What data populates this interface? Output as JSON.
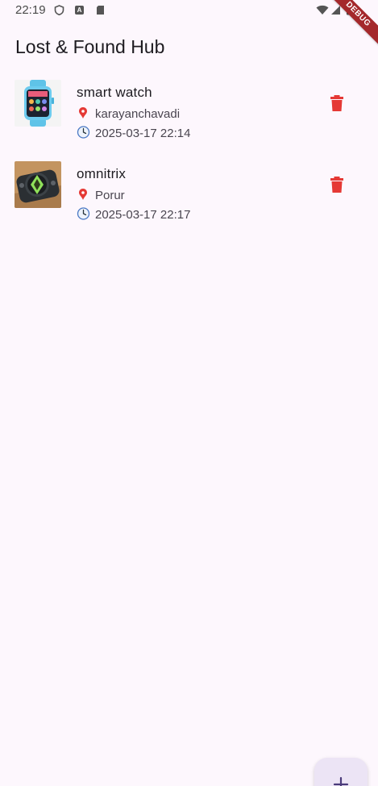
{
  "status_bar": {
    "time": "22:19",
    "icons": [
      "shield-icon",
      "a-icon",
      "sd-card-icon",
      "wifi-icon",
      "signal-icon",
      "battery-icon"
    ]
  },
  "debug_banner": "DEBUG",
  "app_bar": {
    "title": "Lost & Found Hub"
  },
  "items": [
    {
      "title": "smart watch",
      "location": "karayanchavadi",
      "timestamp": "2025-03-17 22:14",
      "image": "smart-watch-photo"
    },
    {
      "title": "omnitrix",
      "location": "Porur",
      "timestamp": "2025-03-17 22:17",
      "image": "omnitrix-photo"
    }
  ],
  "colors": {
    "background": "#fdf7fd",
    "delete": "#e53935",
    "fab_background": "#ece4f5",
    "fab_icon": "#4a3a7a",
    "debug_banner": "#a4282b"
  }
}
